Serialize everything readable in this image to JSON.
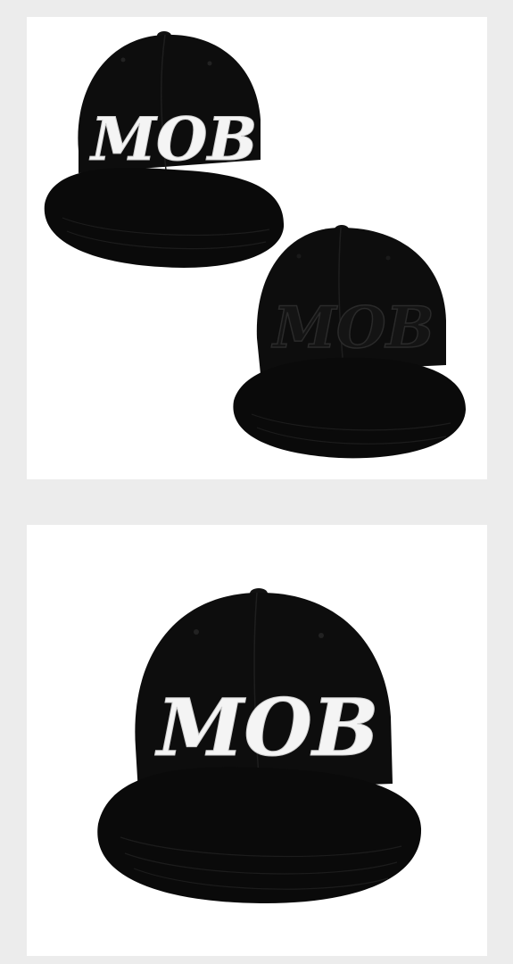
{
  "gallery": {
    "images": [
      {
        "product": "snapback-cap",
        "cap_color": "#0b0b0b",
        "embroidery_text": "MOB",
        "embroidery_color": "#f4f4f4",
        "view": "front-left"
      },
      {
        "product": "snapback-cap",
        "cap_color": "#0b0b0b",
        "embroidery_text": "MOB",
        "embroidery_color": "#141414",
        "view": "front-right"
      },
      {
        "product": "snapback-cap",
        "cap_color": "#0b0b0b",
        "embroidery_text": "MOB",
        "embroidery_color": "#f4f4f4",
        "view": "front"
      }
    ]
  }
}
